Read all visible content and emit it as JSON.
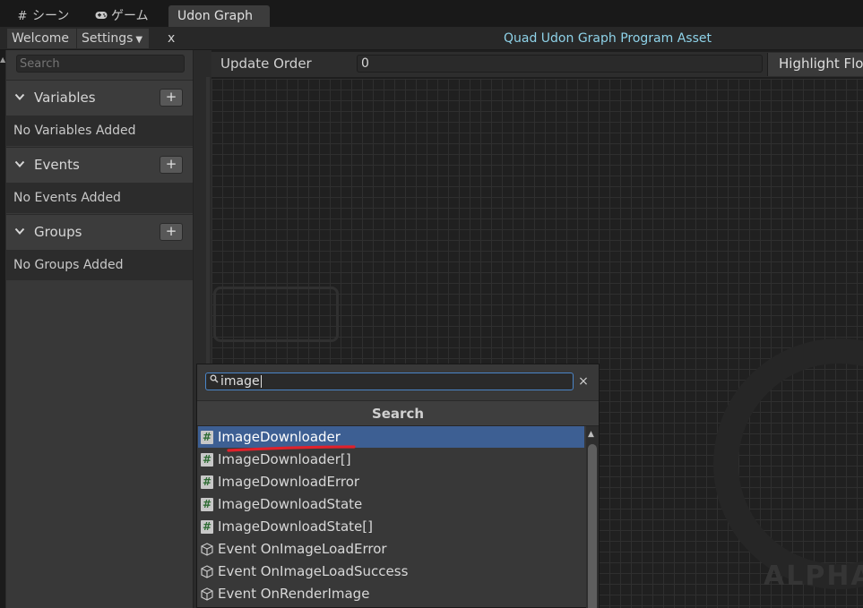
{
  "tabs": [
    {
      "label": "シーン",
      "icon": "grid-icon"
    },
    {
      "label": "ゲーム",
      "icon": "gamepad-icon"
    },
    {
      "label": "Udon Graph",
      "active": true
    }
  ],
  "toolbar": {
    "welcome_label": "Welcome",
    "settings_label": "Settings",
    "close_label": "x",
    "asset_title": "Quad Udon Graph Program Asset"
  },
  "sidebar": {
    "search_placeholder": "Search",
    "sections": [
      {
        "title": "Variables",
        "add_label": "+",
        "empty_text": "No Variables Added"
      },
      {
        "title": "Events",
        "add_label": "+",
        "empty_text": "No Events Added"
      },
      {
        "title": "Groups",
        "add_label": "+",
        "empty_text": "No Groups Added"
      }
    ]
  },
  "graph": {
    "update_order_label": "Update Order",
    "update_order_value": "0",
    "highlight_flow_label": "Highlight Flow",
    "watermark_text": "ALPHA"
  },
  "search_popup": {
    "query": "image",
    "clear_label": "×",
    "header": "Search",
    "results": [
      {
        "label": "ImageDownloader",
        "icon": "hash-script-icon",
        "selected": true
      },
      {
        "label": "ImageDownloader[]",
        "icon": "hash-script-icon"
      },
      {
        "label": "ImageDownloadError",
        "icon": "hash-script-icon"
      },
      {
        "label": "ImageDownloadState",
        "icon": "hash-script-icon"
      },
      {
        "label": "ImageDownloadState[]",
        "icon": "hash-script-icon"
      },
      {
        "label": "Event OnImageLoadError",
        "icon": "cube-icon"
      },
      {
        "label": "Event OnImageLoadSuccess",
        "icon": "cube-icon"
      },
      {
        "label": "Event OnRenderImage",
        "icon": "cube-icon"
      }
    ]
  },
  "colors": {
    "accent_title": "#8ed2e8",
    "selection": "#3d5f93",
    "annotation_red": "#e0212b"
  }
}
